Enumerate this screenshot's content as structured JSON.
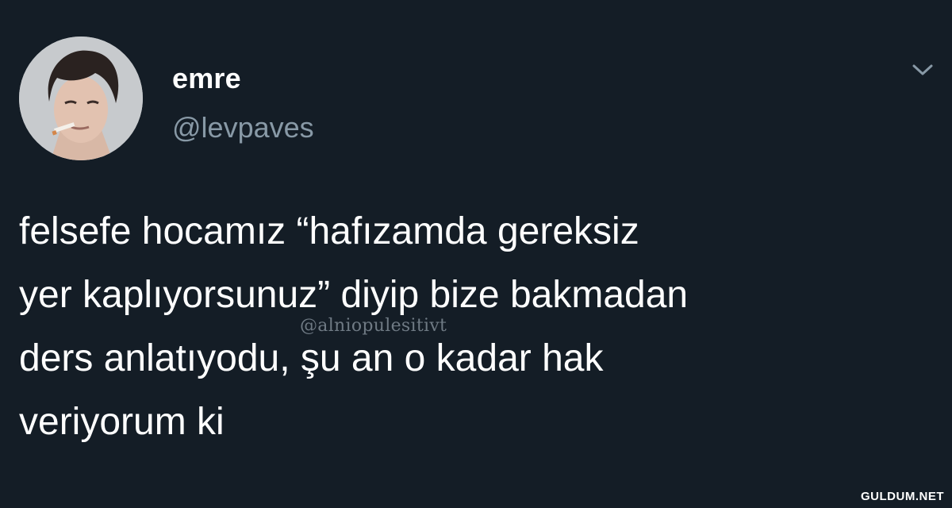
{
  "tweet": {
    "author": {
      "display_name": "emre",
      "handle": "@levpaves",
      "avatar_icon": "profile-photo"
    },
    "menu_icon": "chevron-down-icon",
    "text_lines": [
      "felsefe hocamız “hafızamda gereksiz",
      "yer kaplıyorsunuz” diyip bize bakmadan",
      "ders anlatıyodu, şu an o kadar hak",
      "veriyorum ki"
    ]
  },
  "watermarks": {
    "center": "@alniopulesitivt",
    "corner": "GULDUM.NET"
  },
  "colors": {
    "background": "#141d26",
    "primary_text": "#ffffff",
    "secondary_text": "#8899a6"
  }
}
